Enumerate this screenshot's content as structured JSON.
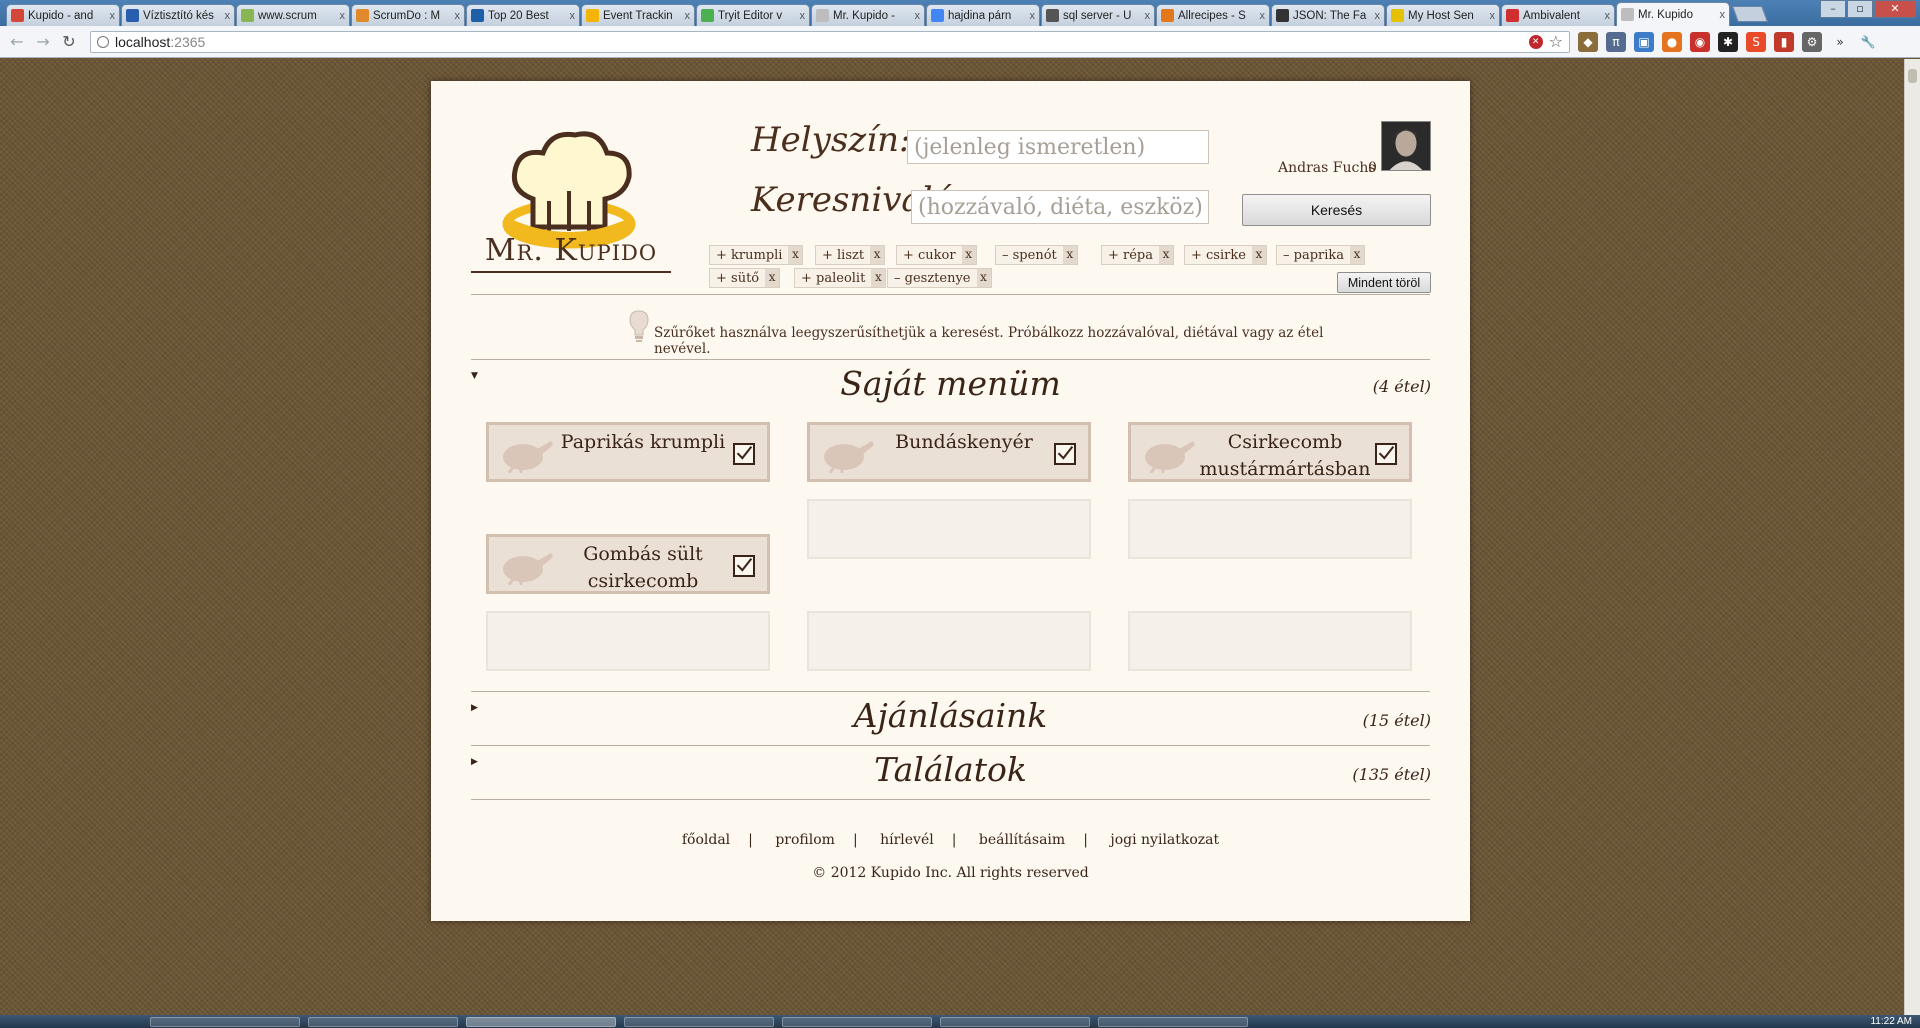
{
  "browser": {
    "tabs": [
      {
        "title": "Kupido - and",
        "color": "#d44638"
      },
      {
        "title": "Víztisztító kés",
        "color": "#2a5fb0"
      },
      {
        "title": "www.scrum",
        "color": "#8ab553"
      },
      {
        "title": "ScrumDo : M",
        "color": "#e08a2c"
      },
      {
        "title": "Top 20 Best",
        "color": "#1c5fa8"
      },
      {
        "title": "Event Trackin",
        "color": "#f4b400"
      },
      {
        "title": "Tryit Editor v",
        "color": "#4caf50"
      },
      {
        "title": "Mr. Kupido -",
        "color": "#bdbdbd"
      },
      {
        "title": "hajdina párn",
        "color": "#4285f4"
      },
      {
        "title": "sql server - U",
        "color": "#555555"
      },
      {
        "title": "Allrecipes - S",
        "color": "#e3781a"
      },
      {
        "title": "JSON: The Fa",
        "color": "#333333"
      },
      {
        "title": "My Host Sen",
        "color": "#e5c100"
      },
      {
        "title": "Ambivalent",
        "color": "#d12f2f"
      },
      {
        "title": "Mr. Kupido",
        "color": "#bdbdbd",
        "active": true
      }
    ],
    "tab_close_label": "x",
    "url_host": "localhost",
    "url_port": ":2365",
    "icons": [
      "back-icon",
      "forward-icon",
      "reload-icon",
      "stop-icon",
      "star-icon",
      "wrench-icon"
    ]
  },
  "site": {
    "logo_text": "Mr. Kupido",
    "location_label": "Helyszín:",
    "location_placeholder": "(jelenleg ismeretlen)",
    "ingredient_label": "Keresnivaló:",
    "ingredient_placeholder": "(hozzávaló, diéta, eszköz)",
    "user_name": "Andras Fuchs",
    "user_count": "0",
    "search_button": "Keresés",
    "clear_all_button": "Mindent töröl",
    "chip_remove": "x",
    "chips": [
      "+ krumpli",
      "+ liszt",
      "+ cukor",
      "– spenót",
      "+ répa",
      "+ csirke",
      "– paprika",
      "+ sütő",
      "+ paleolit",
      "– gesztenye"
    ],
    "hint": "Szűrőket használva leegyszerűsíthetjük a keresést. Próbálkozz hozzávalóval, diétával vagy az étel nevével."
  },
  "sections": {
    "my_menu": {
      "title": "Saját menüm",
      "count": "(4 étel)",
      "expanded": true
    },
    "recommendations": {
      "title": "Ajánlásaink",
      "count": "(15 étel)",
      "expanded": false
    },
    "results": {
      "title": "Találatok",
      "count": "(135 étel)",
      "expanded": false
    }
  },
  "dishes": [
    {
      "name": "Paprikás krumpli",
      "checked": true
    },
    {
      "name": "Bundáskenyér",
      "checked": true
    },
    {
      "name": "Csirkecomb mustármártásban",
      "checked": true
    },
    {
      "name": "Gombás sült csirkecomb",
      "checked": true
    }
  ],
  "footer": {
    "links": [
      "főoldal",
      "profilom",
      "hírlevél",
      "beállításaim",
      "jogi nyilatkozat"
    ],
    "separator": "|",
    "copyright": "© 2012 Kupido Inc. All rights reserved"
  },
  "taskbar": {
    "clock": "11:22 AM"
  }
}
